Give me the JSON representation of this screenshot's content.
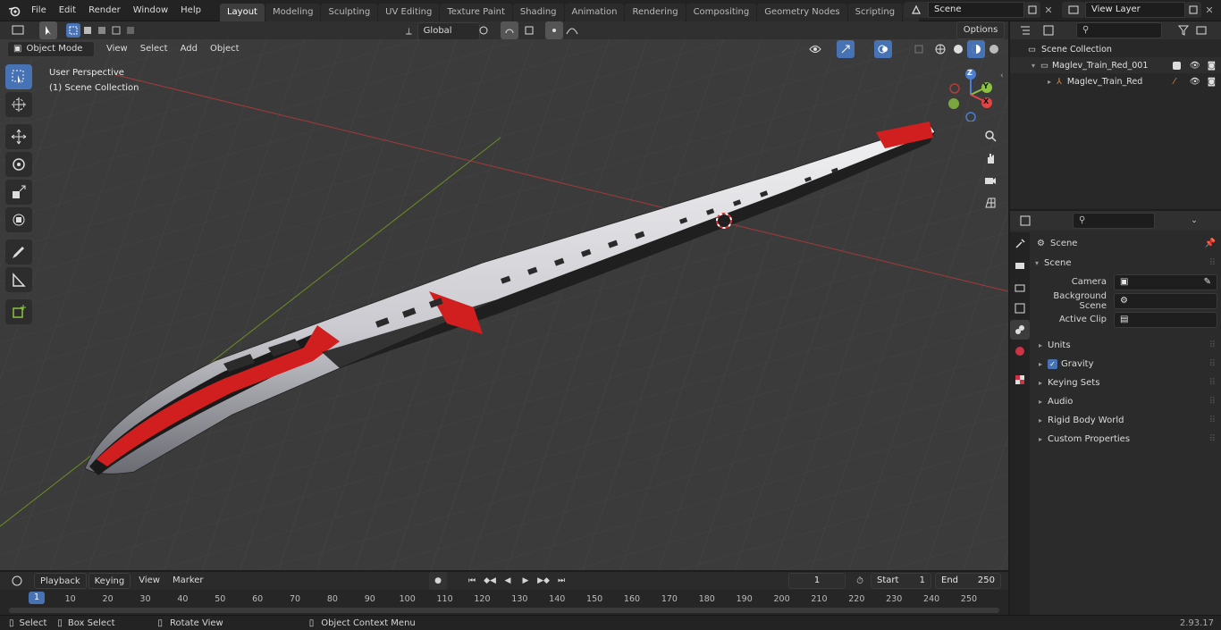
{
  "menu": {
    "items": [
      "File",
      "Edit",
      "Render",
      "Window",
      "Help"
    ]
  },
  "workspaces": {
    "tabs": [
      "Layout",
      "Modeling",
      "Sculpting",
      "UV Editing",
      "Texture Paint",
      "Shading",
      "Animation",
      "Rendering",
      "Compositing",
      "Geometry Nodes",
      "Scripting"
    ],
    "active": "Layout"
  },
  "scene_selector": {
    "value": "Scene"
  },
  "view_layer": {
    "value": "View Layer"
  },
  "viewport_header": {
    "mode": "Object Mode",
    "menus": [
      "View",
      "Select",
      "Add",
      "Object"
    ],
    "transform_orientation": "Global",
    "options_label": "Options"
  },
  "viewport_overlay": {
    "perspective": "User Perspective",
    "collection": "(1) Scene Collection"
  },
  "gizmo": {
    "x": "X",
    "y": "Y",
    "z": "Z"
  },
  "outliner": {
    "root": "Scene Collection",
    "items": [
      {
        "label": "Maglev_Train_Red_001",
        "level": 1
      },
      {
        "label": "Maglev_Train_Red",
        "level": 2
      }
    ]
  },
  "properties": {
    "header": "Scene",
    "section": "Scene",
    "fields": [
      {
        "label": "Camera",
        "value": ""
      },
      {
        "label": "Background Scene",
        "value": ""
      },
      {
        "label": "Active Clip",
        "value": ""
      }
    ],
    "collapsed": [
      "Units",
      "Gravity",
      "Keying Sets",
      "Audio",
      "Rigid Body World",
      "Custom Properties"
    ],
    "gravity_checked": true
  },
  "timeline": {
    "menus": [
      "Playback",
      "Keying",
      "View",
      "Marker"
    ],
    "current_frame": "1",
    "start_label": "Start",
    "start": "1",
    "end_label": "End",
    "end": "250",
    "ticks": [
      "1",
      "10",
      "20",
      "30",
      "40",
      "50",
      "60",
      "70",
      "80",
      "90",
      "100",
      "110",
      "120",
      "130",
      "140",
      "150",
      "160",
      "170",
      "180",
      "190",
      "200",
      "210",
      "220",
      "230",
      "240",
      "250"
    ]
  },
  "statusbar": {
    "select": "Select",
    "box_select": "Box Select",
    "rotate": "Rotate View",
    "context": "Object Context Menu",
    "version": "2.93.17"
  },
  "colors": {
    "accent": "#4772b3",
    "viewport_bg": "#3b3b3b",
    "train_red": "#d11f1f",
    "train_white": "#e8e8ec"
  }
}
